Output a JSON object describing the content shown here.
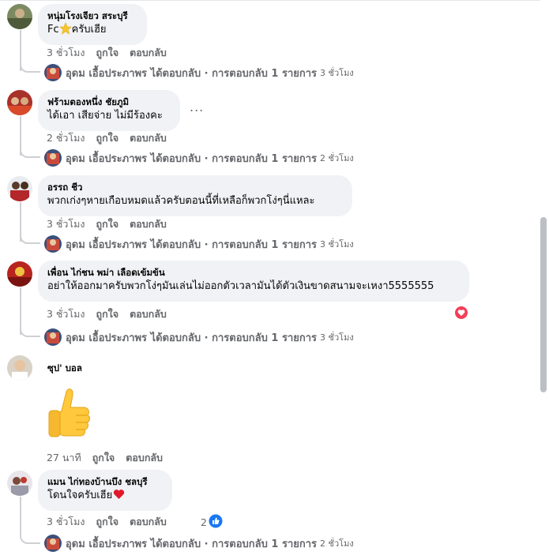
{
  "comments": [
    {
      "author": "หนุ่มโรงเจียว สระบุรี",
      "text_prefix": "Fc",
      "text_emoji": "star",
      "text_suffix": "ครับเฮีย",
      "time": "3 ชั่วโมง",
      "like": "ถูกใจ",
      "reply": "ตอบกลับ",
      "reply_summary": "อุดม เอื้อประภาพร ได้ตอบกลับ · การตอบกลับ 1 รายการ",
      "reply_time": "3 ชั่วโมง"
    },
    {
      "author": "ฟร้ามตองหนึ่ง ชัยภูมิ",
      "text": "ได้เอา เสียจ่าย ไม่มีร้องคะ",
      "more": "...",
      "time": "2 ชั่วโมง",
      "like": "ถูกใจ",
      "reply": "ตอบกลับ",
      "reply_summary": "อุดม เอื้อประภาพร ได้ตอบกลับ · การตอบกลับ 1 รายการ",
      "reply_time": "2 ชั่วโมง"
    },
    {
      "author": "อรรถ ชีว",
      "text": "พวกเก่งๆหายเกือบหมดแล้วครับตอนนี้ที่เหลือก็พวกโง่ๆนี่แหละ",
      "time": "3 ชั่วโมง",
      "like": "ถูกใจ",
      "reply": "ตอบกลับ",
      "reply_summary": "อุดม เอื้อประภาพร ได้ตอบกลับ · การตอบกลับ 1 รายการ",
      "reply_time": "3 ชั่วโมง"
    },
    {
      "author": "เพื่อน ไก่ชน พม่า เลือดเข้มข้น",
      "text": "อย่าให้ออกมาครับพวกโง่ๆมันเล่นไม่ออกตัวเวลามันได้ตัวเงินขาดสนามจะเหงา5555555",
      "time": "3 ชั่วโมง",
      "like": "ถูกใจ",
      "reply": "ตอบกลับ",
      "reaction": "heart",
      "reply_summary": "อุดม เอื้อประภาพร ได้ตอบกลับ · การตอบกลับ 1 รายการ",
      "reply_time": "3 ชั่วโมง"
    },
    {
      "author": "ซุป' บอล",
      "sticker": "thumbs-up",
      "time": "27 นาที",
      "like": "ถูกใจ",
      "reply": "ตอบกลับ"
    },
    {
      "author": "แมน ไก่ทองบ้านบึง ชลบุรี",
      "text": "โดนใจครับเฮีย",
      "text_emoji": "heart",
      "time": "3 ชั่วโมง",
      "like": "ถูกใจ",
      "reply": "ตอบกลับ",
      "like_count": "2",
      "reply_summary": "อุดม เอื้อประภาพร ได้ตอบกลับ · การตอบกลับ 1 รายการ",
      "reply_time": "2 ชั่วโมง"
    }
  ],
  "colors": {
    "bubble": "#f0f2f5",
    "meta": "#65676b",
    "like_blue": "#1877f2",
    "love_red": "#f33e58"
  }
}
